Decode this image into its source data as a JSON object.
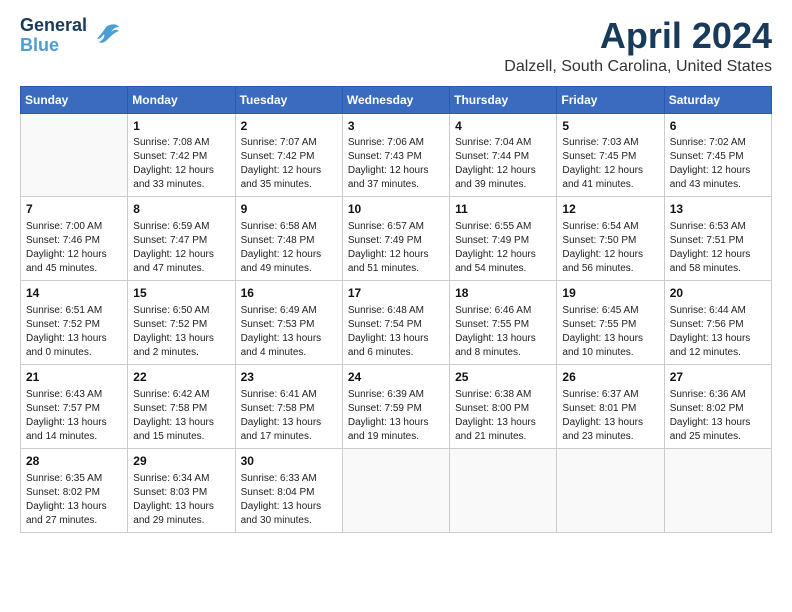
{
  "header": {
    "logo_line1": "General",
    "logo_line2": "Blue",
    "month_title": "April 2024",
    "location": "Dalzell, South Carolina, United States"
  },
  "calendar": {
    "columns": [
      "Sunday",
      "Monday",
      "Tuesday",
      "Wednesday",
      "Thursday",
      "Friday",
      "Saturday"
    ],
    "weeks": [
      [
        {
          "day": "",
          "content": ""
        },
        {
          "day": "1",
          "content": "Sunrise: 7:08 AM\nSunset: 7:42 PM\nDaylight: 12 hours\nand 33 minutes."
        },
        {
          "day": "2",
          "content": "Sunrise: 7:07 AM\nSunset: 7:42 PM\nDaylight: 12 hours\nand 35 minutes."
        },
        {
          "day": "3",
          "content": "Sunrise: 7:06 AM\nSunset: 7:43 PM\nDaylight: 12 hours\nand 37 minutes."
        },
        {
          "day": "4",
          "content": "Sunrise: 7:04 AM\nSunset: 7:44 PM\nDaylight: 12 hours\nand 39 minutes."
        },
        {
          "day": "5",
          "content": "Sunrise: 7:03 AM\nSunset: 7:45 PM\nDaylight: 12 hours\nand 41 minutes."
        },
        {
          "day": "6",
          "content": "Sunrise: 7:02 AM\nSunset: 7:45 PM\nDaylight: 12 hours\nand 43 minutes."
        }
      ],
      [
        {
          "day": "7",
          "content": "Sunrise: 7:00 AM\nSunset: 7:46 PM\nDaylight: 12 hours\nand 45 minutes."
        },
        {
          "day": "8",
          "content": "Sunrise: 6:59 AM\nSunset: 7:47 PM\nDaylight: 12 hours\nand 47 minutes."
        },
        {
          "day": "9",
          "content": "Sunrise: 6:58 AM\nSunset: 7:48 PM\nDaylight: 12 hours\nand 49 minutes."
        },
        {
          "day": "10",
          "content": "Sunrise: 6:57 AM\nSunset: 7:49 PM\nDaylight: 12 hours\nand 51 minutes."
        },
        {
          "day": "11",
          "content": "Sunrise: 6:55 AM\nSunset: 7:49 PM\nDaylight: 12 hours\nand 54 minutes."
        },
        {
          "day": "12",
          "content": "Sunrise: 6:54 AM\nSunset: 7:50 PM\nDaylight: 12 hours\nand 56 minutes."
        },
        {
          "day": "13",
          "content": "Sunrise: 6:53 AM\nSunset: 7:51 PM\nDaylight: 12 hours\nand 58 minutes."
        }
      ],
      [
        {
          "day": "14",
          "content": "Sunrise: 6:51 AM\nSunset: 7:52 PM\nDaylight: 13 hours\nand 0 minutes."
        },
        {
          "day": "15",
          "content": "Sunrise: 6:50 AM\nSunset: 7:52 PM\nDaylight: 13 hours\nand 2 minutes."
        },
        {
          "day": "16",
          "content": "Sunrise: 6:49 AM\nSunset: 7:53 PM\nDaylight: 13 hours\nand 4 minutes."
        },
        {
          "day": "17",
          "content": "Sunrise: 6:48 AM\nSunset: 7:54 PM\nDaylight: 13 hours\nand 6 minutes."
        },
        {
          "day": "18",
          "content": "Sunrise: 6:46 AM\nSunset: 7:55 PM\nDaylight: 13 hours\nand 8 minutes."
        },
        {
          "day": "19",
          "content": "Sunrise: 6:45 AM\nSunset: 7:55 PM\nDaylight: 13 hours\nand 10 minutes."
        },
        {
          "day": "20",
          "content": "Sunrise: 6:44 AM\nSunset: 7:56 PM\nDaylight: 13 hours\nand 12 minutes."
        }
      ],
      [
        {
          "day": "21",
          "content": "Sunrise: 6:43 AM\nSunset: 7:57 PM\nDaylight: 13 hours\nand 14 minutes."
        },
        {
          "day": "22",
          "content": "Sunrise: 6:42 AM\nSunset: 7:58 PM\nDaylight: 13 hours\nand 15 minutes."
        },
        {
          "day": "23",
          "content": "Sunrise: 6:41 AM\nSunset: 7:58 PM\nDaylight: 13 hours\nand 17 minutes."
        },
        {
          "day": "24",
          "content": "Sunrise: 6:39 AM\nSunset: 7:59 PM\nDaylight: 13 hours\nand 19 minutes."
        },
        {
          "day": "25",
          "content": "Sunrise: 6:38 AM\nSunset: 8:00 PM\nDaylight: 13 hours\nand 21 minutes."
        },
        {
          "day": "26",
          "content": "Sunrise: 6:37 AM\nSunset: 8:01 PM\nDaylight: 13 hours\nand 23 minutes."
        },
        {
          "day": "27",
          "content": "Sunrise: 6:36 AM\nSunset: 8:02 PM\nDaylight: 13 hours\nand 25 minutes."
        }
      ],
      [
        {
          "day": "28",
          "content": "Sunrise: 6:35 AM\nSunset: 8:02 PM\nDaylight: 13 hours\nand 27 minutes."
        },
        {
          "day": "29",
          "content": "Sunrise: 6:34 AM\nSunset: 8:03 PM\nDaylight: 13 hours\nand 29 minutes."
        },
        {
          "day": "30",
          "content": "Sunrise: 6:33 AM\nSunset: 8:04 PM\nDaylight: 13 hours\nand 30 minutes."
        },
        {
          "day": "",
          "content": ""
        },
        {
          "day": "",
          "content": ""
        },
        {
          "day": "",
          "content": ""
        },
        {
          "day": "",
          "content": ""
        }
      ]
    ]
  }
}
